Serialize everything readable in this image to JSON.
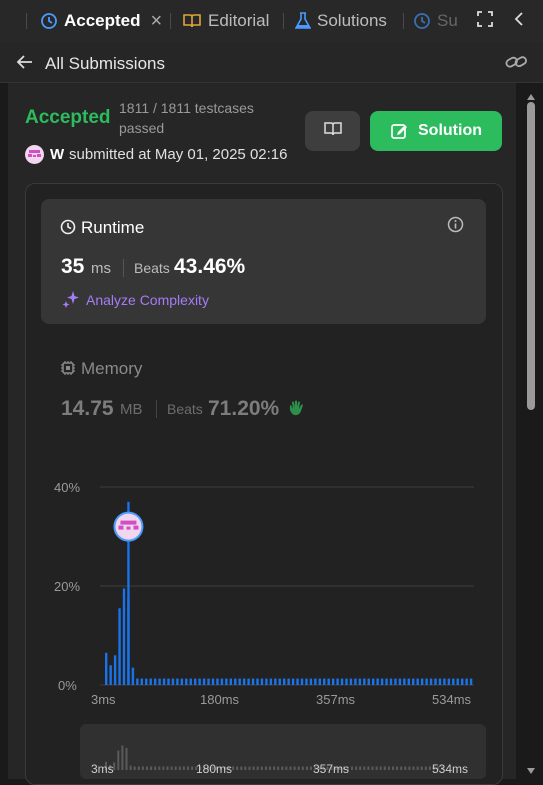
{
  "tabs": [
    {
      "label": "Accepted",
      "icon": "history-icon",
      "active": true
    },
    {
      "label": "Editorial",
      "icon": "book-icon"
    },
    {
      "label": "Solutions",
      "icon": "flask-icon"
    },
    {
      "label": "Su",
      "icon": "history-icon"
    }
  ],
  "nav": {
    "back_label": "All Submissions"
  },
  "submission": {
    "status": "Accepted",
    "testcases": "1811 / 1811 testcases",
    "passed": "passed",
    "avatar_letter": "W",
    "submitted_at": "submitted at May 01, 2025 02:16",
    "solution_button": "Solution"
  },
  "runtime": {
    "title": "Runtime",
    "value": "35",
    "unit": "ms",
    "beats_label": "Beats",
    "beats_value": "43.46%",
    "analyze": "Analyze Complexity"
  },
  "memory": {
    "title": "Memory",
    "value": "14.75",
    "unit": "MB",
    "beats_label": "Beats",
    "beats_value": "71.20%"
  },
  "chart_data": {
    "type": "bar",
    "yticks": [
      "40%",
      "20%",
      "0%"
    ],
    "xticks": [
      "3ms",
      "180ms",
      "357ms",
      "534ms"
    ],
    "ylim": [
      0,
      40
    ],
    "values": [
      6.5,
      4,
      6,
      15.5,
      19.5,
      17.5,
      3.5,
      1.3,
      1.3,
      1.3,
      1.3,
      1.3,
      1.3,
      1.3,
      1.3,
      1.3,
      1.3,
      1.3,
      1.3,
      1.3,
      1.3,
      1.3,
      1.3,
      1.3,
      1.3,
      1.3,
      1.3,
      1.3,
      1.3,
      1.3,
      1.3,
      1.3,
      1.3,
      1.3,
      1.3,
      1.3,
      1.3,
      1.3,
      1.3,
      1.3,
      1.3,
      1.3,
      1.3,
      1.3,
      1.3,
      1.3,
      1.3,
      1.3,
      1.3,
      1.3,
      1.3,
      1.3,
      1.3,
      1.3,
      1.3,
      1.3,
      1.3,
      1.3,
      1.3,
      1.3,
      1.3,
      1.3,
      1.3,
      1.3,
      1.3,
      1.3,
      1.3,
      1.3,
      1.3,
      1.3,
      1.3,
      1.3,
      1.3,
      1.3,
      1.3,
      1.3,
      1.3,
      1.3,
      1.3,
      1.3,
      1.3,
      1.3,
      1.3
    ],
    "highlight_index": 5,
    "highlight_peak": 37,
    "mini_xticks": [
      "3ms",
      "180ms",
      "357ms",
      "534ms"
    ]
  },
  "colors": {
    "accent_green": "#2cbb5d",
    "bar_blue": "#1a73e8",
    "purple": "#a57cf6"
  }
}
